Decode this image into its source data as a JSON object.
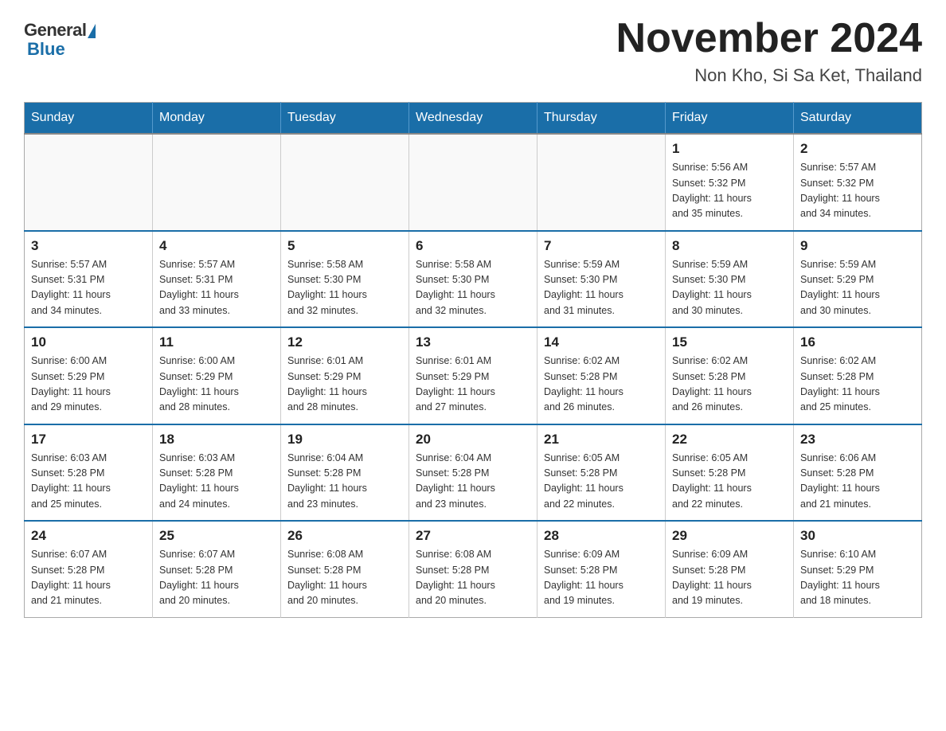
{
  "header": {
    "logo_general": "General",
    "logo_blue": "Blue",
    "month_title": "November 2024",
    "location": "Non Kho, Si Sa Ket, Thailand"
  },
  "weekdays": [
    "Sunday",
    "Monday",
    "Tuesday",
    "Wednesday",
    "Thursday",
    "Friday",
    "Saturday"
  ],
  "weeks": [
    [
      {
        "day": "",
        "info": ""
      },
      {
        "day": "",
        "info": ""
      },
      {
        "day": "",
        "info": ""
      },
      {
        "day": "",
        "info": ""
      },
      {
        "day": "",
        "info": ""
      },
      {
        "day": "1",
        "info": "Sunrise: 5:56 AM\nSunset: 5:32 PM\nDaylight: 11 hours\nand 35 minutes."
      },
      {
        "day": "2",
        "info": "Sunrise: 5:57 AM\nSunset: 5:32 PM\nDaylight: 11 hours\nand 34 minutes."
      }
    ],
    [
      {
        "day": "3",
        "info": "Sunrise: 5:57 AM\nSunset: 5:31 PM\nDaylight: 11 hours\nand 34 minutes."
      },
      {
        "day": "4",
        "info": "Sunrise: 5:57 AM\nSunset: 5:31 PM\nDaylight: 11 hours\nand 33 minutes."
      },
      {
        "day": "5",
        "info": "Sunrise: 5:58 AM\nSunset: 5:30 PM\nDaylight: 11 hours\nand 32 minutes."
      },
      {
        "day": "6",
        "info": "Sunrise: 5:58 AM\nSunset: 5:30 PM\nDaylight: 11 hours\nand 32 minutes."
      },
      {
        "day": "7",
        "info": "Sunrise: 5:59 AM\nSunset: 5:30 PM\nDaylight: 11 hours\nand 31 minutes."
      },
      {
        "day": "8",
        "info": "Sunrise: 5:59 AM\nSunset: 5:30 PM\nDaylight: 11 hours\nand 30 minutes."
      },
      {
        "day": "9",
        "info": "Sunrise: 5:59 AM\nSunset: 5:29 PM\nDaylight: 11 hours\nand 30 minutes."
      }
    ],
    [
      {
        "day": "10",
        "info": "Sunrise: 6:00 AM\nSunset: 5:29 PM\nDaylight: 11 hours\nand 29 minutes."
      },
      {
        "day": "11",
        "info": "Sunrise: 6:00 AM\nSunset: 5:29 PM\nDaylight: 11 hours\nand 28 minutes."
      },
      {
        "day": "12",
        "info": "Sunrise: 6:01 AM\nSunset: 5:29 PM\nDaylight: 11 hours\nand 28 minutes."
      },
      {
        "day": "13",
        "info": "Sunrise: 6:01 AM\nSunset: 5:29 PM\nDaylight: 11 hours\nand 27 minutes."
      },
      {
        "day": "14",
        "info": "Sunrise: 6:02 AM\nSunset: 5:28 PM\nDaylight: 11 hours\nand 26 minutes."
      },
      {
        "day": "15",
        "info": "Sunrise: 6:02 AM\nSunset: 5:28 PM\nDaylight: 11 hours\nand 26 minutes."
      },
      {
        "day": "16",
        "info": "Sunrise: 6:02 AM\nSunset: 5:28 PM\nDaylight: 11 hours\nand 25 minutes."
      }
    ],
    [
      {
        "day": "17",
        "info": "Sunrise: 6:03 AM\nSunset: 5:28 PM\nDaylight: 11 hours\nand 25 minutes."
      },
      {
        "day": "18",
        "info": "Sunrise: 6:03 AM\nSunset: 5:28 PM\nDaylight: 11 hours\nand 24 minutes."
      },
      {
        "day": "19",
        "info": "Sunrise: 6:04 AM\nSunset: 5:28 PM\nDaylight: 11 hours\nand 23 minutes."
      },
      {
        "day": "20",
        "info": "Sunrise: 6:04 AM\nSunset: 5:28 PM\nDaylight: 11 hours\nand 23 minutes."
      },
      {
        "day": "21",
        "info": "Sunrise: 6:05 AM\nSunset: 5:28 PM\nDaylight: 11 hours\nand 22 minutes."
      },
      {
        "day": "22",
        "info": "Sunrise: 6:05 AM\nSunset: 5:28 PM\nDaylight: 11 hours\nand 22 minutes."
      },
      {
        "day": "23",
        "info": "Sunrise: 6:06 AM\nSunset: 5:28 PM\nDaylight: 11 hours\nand 21 minutes."
      }
    ],
    [
      {
        "day": "24",
        "info": "Sunrise: 6:07 AM\nSunset: 5:28 PM\nDaylight: 11 hours\nand 21 minutes."
      },
      {
        "day": "25",
        "info": "Sunrise: 6:07 AM\nSunset: 5:28 PM\nDaylight: 11 hours\nand 20 minutes."
      },
      {
        "day": "26",
        "info": "Sunrise: 6:08 AM\nSunset: 5:28 PM\nDaylight: 11 hours\nand 20 minutes."
      },
      {
        "day": "27",
        "info": "Sunrise: 6:08 AM\nSunset: 5:28 PM\nDaylight: 11 hours\nand 20 minutes."
      },
      {
        "day": "28",
        "info": "Sunrise: 6:09 AM\nSunset: 5:28 PM\nDaylight: 11 hours\nand 19 minutes."
      },
      {
        "day": "29",
        "info": "Sunrise: 6:09 AM\nSunset: 5:28 PM\nDaylight: 11 hours\nand 19 minutes."
      },
      {
        "day": "30",
        "info": "Sunrise: 6:10 AM\nSunset: 5:29 PM\nDaylight: 11 hours\nand 18 minutes."
      }
    ]
  ]
}
